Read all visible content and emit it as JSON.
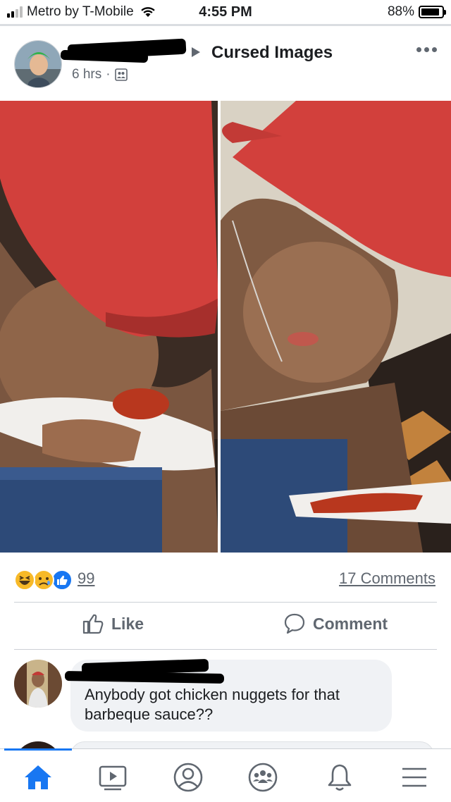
{
  "status_bar": {
    "carrier": "Metro by T-Mobile",
    "time": "4:55 PM",
    "battery_percent": "88%",
    "battery_level": 0.88,
    "signal_bars": 4,
    "signal_bars_filled": 2
  },
  "post": {
    "group_name": "Cursed Images",
    "time_ago": "6 hrs",
    "separator": "·",
    "privacy_icon": "group-icon",
    "author_name_redacted": true,
    "photo_description_icon": "post-photo"
  },
  "reactions": {
    "icons": [
      "haha-icon",
      "sad-icon",
      "like-icon"
    ],
    "count": "99",
    "comments_label": "17 Comments"
  },
  "actions": {
    "like_label": "Like",
    "comment_label": "Comment"
  },
  "comment": {
    "author_redacted": true,
    "text": "Anybody got chicken nuggets for that barbeque sauce??"
  },
  "bottom_nav": {
    "items": [
      "home-icon",
      "video-icon",
      "profile-icon",
      "groups-icon",
      "notifications-icon",
      "menu-icon"
    ],
    "active": "home-icon"
  },
  "colors": {
    "accent": "#1877f2",
    "muted_text": "#606770",
    "bubble": "#f0f2f5",
    "cap_red": "#d2403c"
  }
}
